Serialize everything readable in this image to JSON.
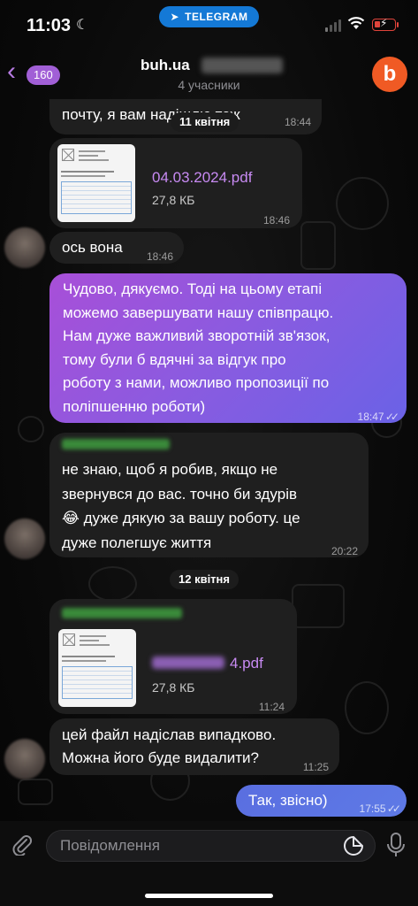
{
  "status_bar": {
    "time": "11:03",
    "app_pill": "TELEGRAM"
  },
  "header": {
    "back_count": "160",
    "title": "buh.ua",
    "subtitle": "4 учасники",
    "avatar_letter": "b"
  },
  "messages": {
    "m0": {
      "text": "почту, я вам надішлю теж",
      "time": "18:44"
    },
    "date1": "11 квітня",
    "m1": {
      "file_name": "04.03.2024.pdf",
      "file_size": "27,8 КБ",
      "time": "18:46"
    },
    "m2": {
      "text": "ось вона",
      "time": "18:46"
    },
    "m3": {
      "lines": [
        "Чудово, дякуємо. Тоді на цьому етапі",
        "можемо завершувати нашу співпрацю.",
        "Нам дуже важливий зворотній зв'язок,",
        "тому були б вдячні за відгук про",
        "роботу з нами, можливо пропозиції по",
        "поліпшенню роботи)"
      ],
      "time": "18:47"
    },
    "m4": {
      "lines": [
        "не знаю, щоб я робив, якщо не",
        "звернувся до вас. точно би здурів",
        "😂 дуже дякую за вашу роботу. це",
        "дуже полегшує життя"
      ],
      "time": "20:22"
    },
    "date2": "12 квітня",
    "m5": {
      "file_name_suffix": "4.pdf",
      "file_size": "27,8 КБ",
      "time": "11:24"
    },
    "m6": {
      "lines": [
        "цей файл надіслав випадково.",
        "Можна його буде видалити?"
      ],
      "time": "11:25"
    },
    "m7": {
      "text": "Так, звісно)",
      "time": "17:55"
    }
  },
  "composer": {
    "placeholder": "Повідомлення"
  },
  "colors": {
    "accent": "#a15fd6",
    "telegram_blue": "#1479d6",
    "brand_orange": "#f05a24"
  }
}
